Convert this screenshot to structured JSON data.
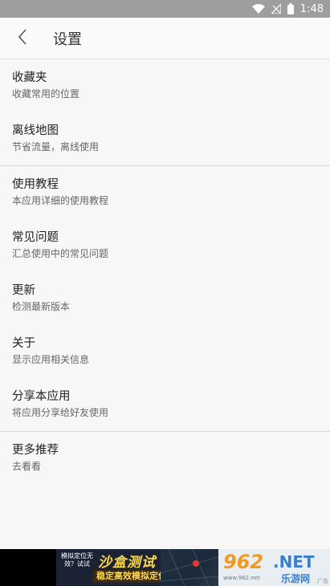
{
  "status_bar": {
    "time": "1:48",
    "battery": "battery-full",
    "wifi": "wifi-icon",
    "signal": "signal-off"
  },
  "app_bar": {
    "title": "设置"
  },
  "items": [
    {
      "title": "收藏夹",
      "subtitle": "收藏常用的位置"
    },
    {
      "title": "离线地图",
      "subtitle": "节省流量，离线使用"
    },
    {
      "title": "使用教程",
      "subtitle": "本应用详细的使用教程"
    },
    {
      "title": "常见问题",
      "subtitle": "汇总使用中的常见问题"
    },
    {
      "title": "更新",
      "subtitle": "检测最新版本"
    },
    {
      "title": "关于",
      "subtitle": "显示应用相关信息"
    },
    {
      "title": "分享本应用",
      "subtitle": "将应用分享给好友使用"
    },
    {
      "title": "更多推荐",
      "subtitle": "去看看"
    }
  ],
  "ad": {
    "small_text": "模拟定位无效？试试",
    "title": "沙盒测试",
    "subtitle": "稳定高效模拟定位",
    "logo_number": "962",
    "logo_net": ".NET",
    "logo_cn": "乐游网",
    "logo_url": "www.962.net",
    "mark": "广告"
  }
}
